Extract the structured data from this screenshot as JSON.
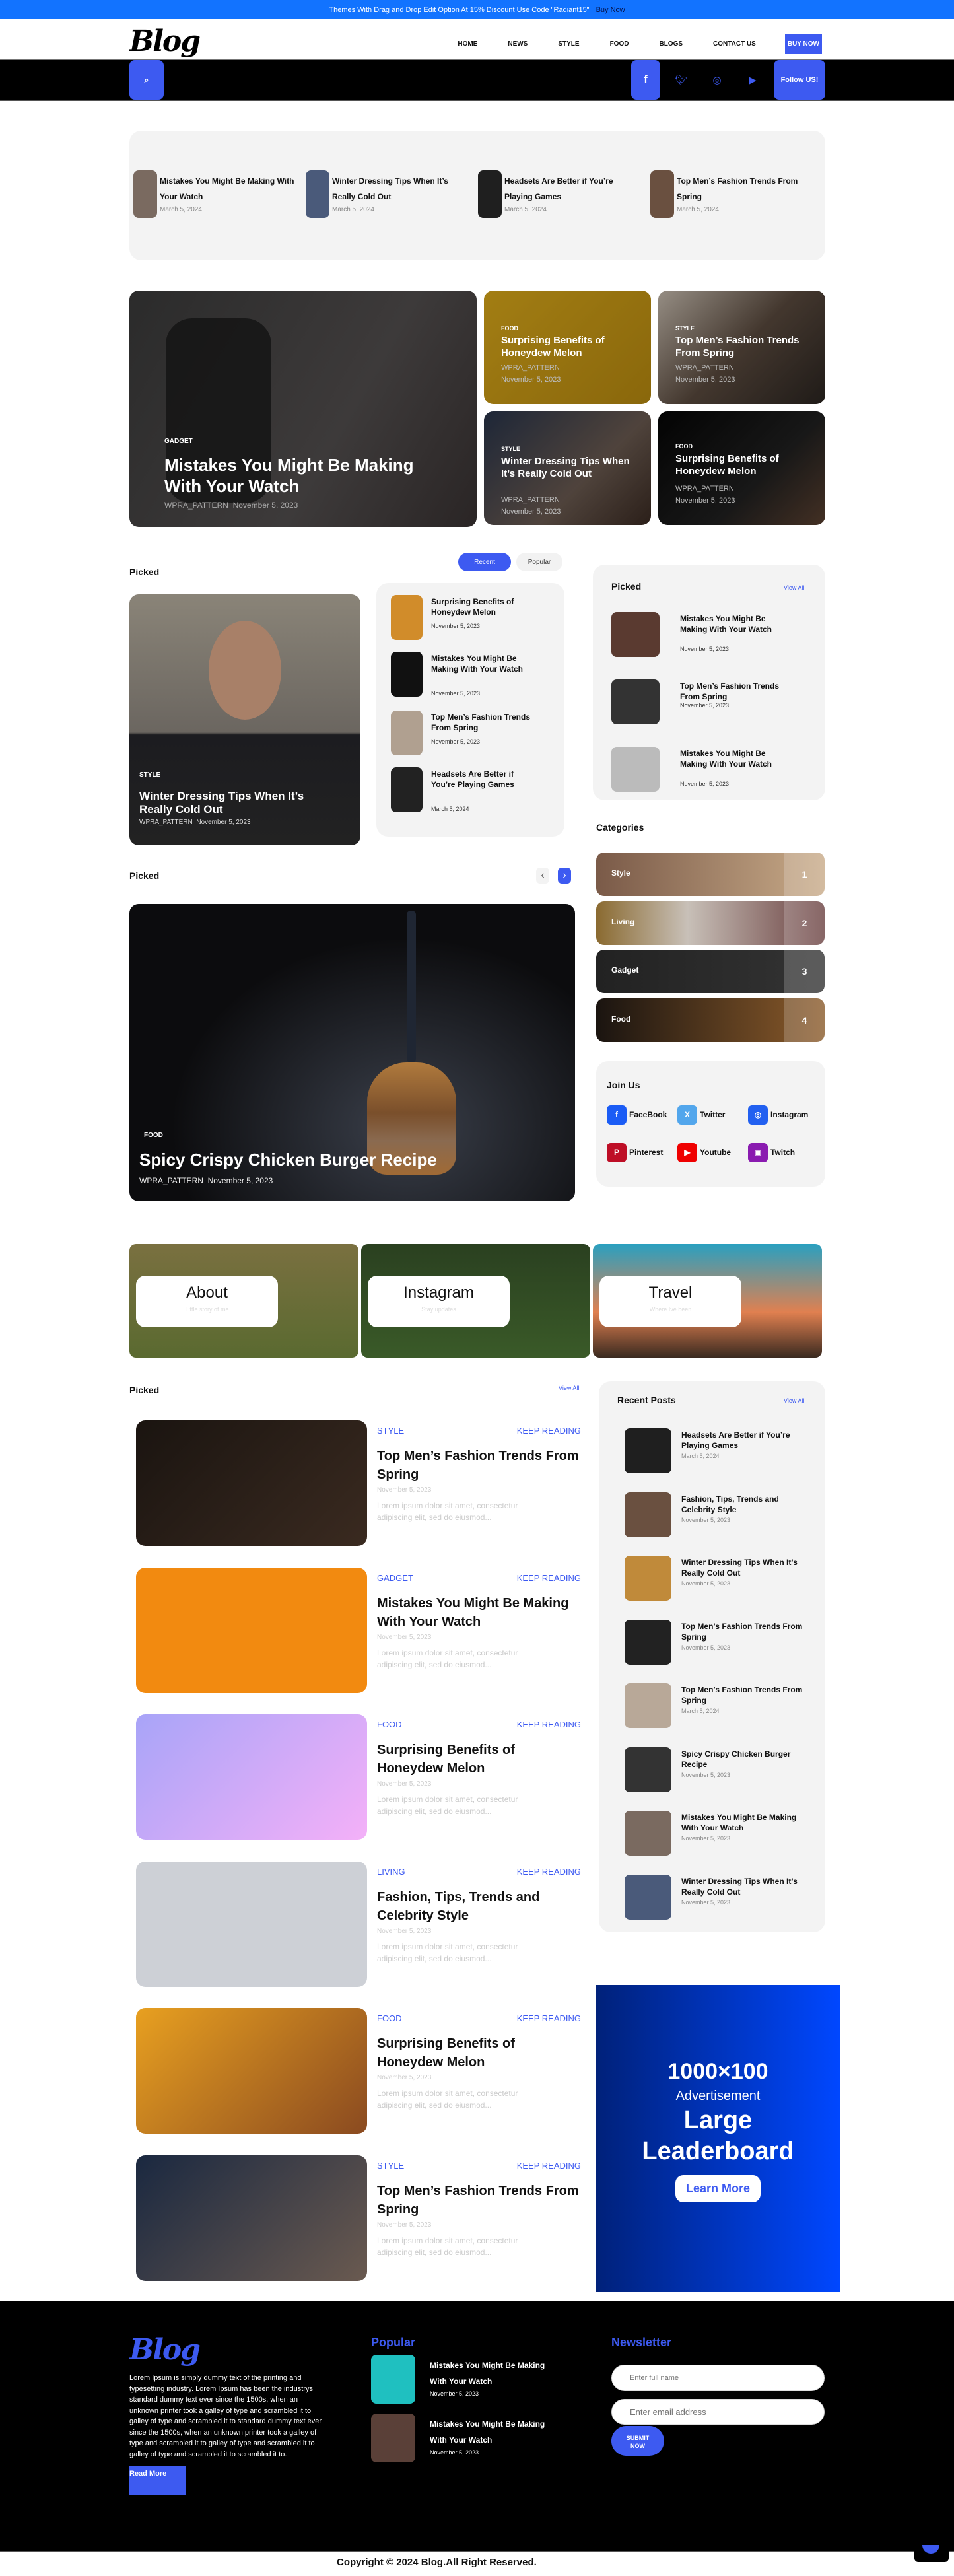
{
  "promo": {
    "text": "Themes With Drag and Drop Edit Option At 15% Discount Use Code \"Radiant15\"",
    "link": "Buy Now"
  },
  "header": {
    "logo": "Blog",
    "nav": [
      "HOME",
      "NEWS",
      "STYLE",
      "FOOD",
      "BLOGS",
      "CONTACT US"
    ],
    "buy_now": "BUY NOW"
  },
  "toolbar": {
    "follow_label": "Follow US!",
    "icons": [
      "search-icon",
      "facebook-icon",
      "twitter-icon",
      "instagram-icon",
      "youtube-icon"
    ]
  },
  "top_strip": [
    {
      "title": "Mistakes You Might Be Making With Your Watch",
      "date": "March 5, 2024"
    },
    {
      "title": "Winter Dressing Tips When It’s Really Cold Out",
      "date": "March 5, 2024"
    },
    {
      "title": "Headsets Are Better if You’re Playing Games",
      "date": "March 5, 2024"
    },
    {
      "title": "Top Men’s Fashion Trends From Spring",
      "date": "March 5, 2024"
    }
  ],
  "hero": {
    "main": {
      "tag": "GADGET",
      "title": "Mistakes You Might Be Making With Your Watch",
      "author": "WPRA_PATTERN",
      "date": "November 5, 2023"
    },
    "tiles": [
      {
        "tag": "FOOD",
        "title": "Surprising Benefits of Honeydew Melon",
        "author": "WPRA_PATTERN",
        "date": "November 5, 2023"
      },
      {
        "tag": "STYLE",
        "title": "Top Men’s Fashion Trends From Spring",
        "author": "WPRA_PATTERN",
        "date": "November 5, 2023"
      },
      {
        "tag": "STYLE",
        "title": "Winter Dressing Tips When It’s Really Cold Out",
        "author": "WPRA_PATTERN",
        "date": "November 5, 2023"
      },
      {
        "tag": "FOOD",
        "title": "Surprising Benefits of Honeydew Melon",
        "author": "WPRA_PATTERN",
        "date": "November 5, 2023"
      }
    ]
  },
  "picked1": {
    "heading": "Picked",
    "tabs": [
      "Recent",
      "Popular"
    ],
    "active_tab": "Recent",
    "feature": {
      "tag": "STYLE",
      "title": "Winter Dressing Tips When It’s Really Cold Out",
      "author": "WPRA_PATTERN",
      "date": "November 5, 2023"
    },
    "list": [
      {
        "title": "Surprising Benefits of Honeydew Melon",
        "date": "November 5, 2023"
      },
      {
        "title": "Mistakes You Might Be Making With Your Watch",
        "date": "November 5, 2023"
      },
      {
        "title": "Top Men’s Fashion Trends From Spring",
        "date": "November 5, 2023"
      },
      {
        "title": "Headsets Are Better if You’re Playing Games",
        "date": "March 5, 2024"
      }
    ]
  },
  "sidebar_picked": {
    "heading": "Picked",
    "view_all": "View All",
    "items": [
      {
        "title": "Mistakes You Might Be Making With Your Watch",
        "date": "November 5, 2023"
      },
      {
        "title": "Top Men’s Fashion Trends From Spring",
        "date": "November 5, 2023"
      },
      {
        "title": "Mistakes You Might Be Making With Your Watch",
        "date": "November 5, 2023"
      }
    ]
  },
  "categories": {
    "heading": "Categories",
    "items": [
      {
        "name": "Style",
        "count": "1"
      },
      {
        "name": "Living",
        "count": "2"
      },
      {
        "name": "Gadget",
        "count": "3"
      },
      {
        "name": "Food",
        "count": "4"
      }
    ]
  },
  "join_us": {
    "heading": "Join Us",
    "items": [
      {
        "label": "FaceBook",
        "icon": "f",
        "color": "#1b5cf5"
      },
      {
        "label": "Twitter",
        "icon": "X",
        "color": "#52a6ec"
      },
      {
        "label": "Instagram",
        "icon": "◎",
        "color": "#2260f0"
      },
      {
        "label": "Pinterest",
        "icon": "P",
        "color": "#be0e26"
      },
      {
        "label": "Youtube",
        "icon": "▶",
        "color": "#ef0000"
      },
      {
        "label": "Twitch",
        "icon": "▣",
        "color": "#8a1bb0"
      }
    ]
  },
  "picked2": {
    "heading": "Picked",
    "prev": "‹",
    "next": "›",
    "feature": {
      "tag": "FOOD",
      "title": "Spicy Crispy Chicken Burger Recipe",
      "author": "WPRA_PATTERN",
      "date": "November 5, 2023"
    }
  },
  "banners": [
    {
      "title": "About",
      "subtitle": "Little story of me"
    },
    {
      "title": "Instagram",
      "subtitle": "Stay updates"
    },
    {
      "title": "Travel",
      "subtitle": "Where Ive been"
    }
  ],
  "picked3": {
    "heading": "Picked",
    "view_all": "View All",
    "keep_reading": "KEEP READING",
    "posts": [
      {
        "cat": "STYLE",
        "title": "Top Men’s Fashion Trends From Spring",
        "date": "November 5, 2023",
        "desc": "Lorem ipsum dolor sit amet, consectetur adipiscing elit, sed do eiusmod..."
      },
      {
        "cat": "GADGET",
        "title": "Mistakes You Might Be Making With Your Watch",
        "date": "November 5, 2023",
        "desc": "Lorem ipsum dolor sit amet, consectetur adipiscing elit, sed do eiusmod..."
      },
      {
        "cat": "FOOD",
        "title": "Surprising Benefits of Honeydew Melon",
        "date": "November 5, 2023",
        "desc": "Lorem ipsum dolor sit amet, consectetur adipiscing elit, sed do eiusmod..."
      },
      {
        "cat": "LIVING",
        "title": "Fashion, Tips, Trends and Celebrity Style",
        "date": "November 5, 2023",
        "desc": "Lorem ipsum dolor sit amet, consectetur adipiscing elit, sed do eiusmod..."
      },
      {
        "cat": "FOOD",
        "title": "Surprising Benefits of Honeydew Melon",
        "date": "November 5, 2023",
        "desc": "Lorem ipsum dolor sit amet, consectetur adipiscing elit, sed do eiusmod..."
      },
      {
        "cat": "STYLE",
        "title": "Top Men’s Fashion Trends From Spring",
        "date": "November 5, 2023",
        "desc": "Lorem ipsum dolor sit amet, consectetur adipiscing elit, sed do eiusmod..."
      }
    ]
  },
  "recent_posts": {
    "heading": "Recent Posts",
    "view_all": "View All",
    "items": [
      {
        "title": "Headsets Are Better if You’re Playing Games",
        "date": "March 5, 2024"
      },
      {
        "title": "Fashion, Tips, Trends and Celebrity Style",
        "date": "November 5, 2023"
      },
      {
        "title": "Winter Dressing Tips When It’s Really Cold Out",
        "date": "November 5, 2023"
      },
      {
        "title": "Top Men’s Fashion Trends From Spring",
        "date": "November 5, 2023"
      },
      {
        "title": "Top Men’s Fashion Trends From Spring",
        "date": "March 5, 2024"
      },
      {
        "title": "Spicy Crispy Chicken Burger Recipe",
        "date": "November 5, 2023"
      },
      {
        "title": "Mistakes You Might Be Making With Your Watch",
        "date": "November 5, 2023"
      },
      {
        "title": "Winter Dressing Tips When It’s Really Cold Out",
        "date": "November 5, 2023"
      }
    ]
  },
  "ad": {
    "size": "1000×100",
    "label": "Advertisement",
    "line1": "Large",
    "line2": "Leaderboard",
    "button": "Learn More"
  },
  "footer": {
    "logo": "Blog",
    "about": "Lorem Ipsum is simply dummy text of the printing and typesetting industry. Lorem Ipsum has been the industrys standard dummy text ever since the 1500s, when an unknown printer took a galley of type and scrambled it to galley of type and scrambled it to standard dummy text ever since the 1500s, when an unknown printer took a galley of type and scrambled it to galley of type and scrambled it to galley of type and scrambled it to scrambled it to.",
    "read_more": "Read More",
    "popular_heading": "Popular",
    "popular": [
      {
        "title": "Mistakes You Might Be Making With Your Watch",
        "date": "November 5, 2023"
      },
      {
        "title": "Mistakes You Might Be Making With Your Watch",
        "date": "November 5, 2023"
      }
    ],
    "newsletter_heading": "Newsletter",
    "name_placeholder": "Enter full name",
    "email_placeholder": "Enter email address",
    "submit": "SUBMIT NOW",
    "copyright": "Copyright © 2024 Blog.All Right Reserved."
  },
  "colors": {
    "accent": "#3d5af1",
    "promo": "#1273ff",
    "ad_start": "#00217a",
    "ad_end": "#0047ff"
  }
}
